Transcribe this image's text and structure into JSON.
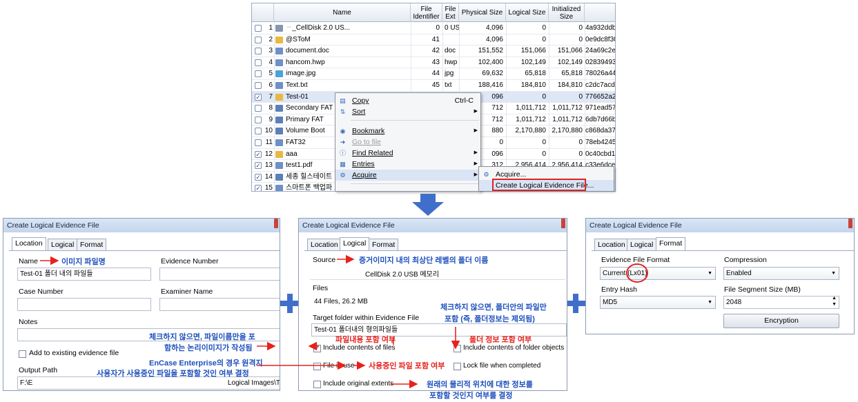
{
  "table": {
    "headers": [
      "Name",
      "File Identifier",
      "File Ext",
      "Physical Size",
      "Logical Size",
      "Initialized Size"
    ],
    "rows": [
      {
        "n": "1",
        "checked": false,
        "icon": "disk-icon",
        "name": "ᆢ_CellDisk 2.0 US...",
        "fid": "0",
        "ext": "0 US...",
        "phys": "4,096",
        "log": "0",
        "init": "0",
        "hash": "4a932ddb"
      },
      {
        "n": "2",
        "checked": false,
        "icon": "folder-icon",
        "name": "@SToM",
        "fid": "41",
        "ext": "",
        "phys": "4,096",
        "log": "0",
        "init": "0",
        "hash": "0e9dc8f30"
      },
      {
        "n": "3",
        "checked": false,
        "icon": "document-icon",
        "name": "document.doc",
        "fid": "42",
        "ext": "doc",
        "phys": "151,552",
        "log": "151,066",
        "init": "151,066",
        "hash": "24a69c2eb"
      },
      {
        "n": "4",
        "checked": false,
        "icon": "document-icon",
        "name": "hancom.hwp",
        "fid": "43",
        "ext": "hwp",
        "phys": "102,400",
        "log": "102,149",
        "init": "102,149",
        "hash": "02839493e"
      },
      {
        "n": "5",
        "checked": false,
        "icon": "image-icon",
        "name": "image.jpg",
        "fid": "44",
        "ext": "jpg",
        "phys": "69,632",
        "log": "65,818",
        "init": "65,818",
        "hash": "78026a442"
      },
      {
        "n": "6",
        "checked": false,
        "icon": "document-icon",
        "name": "Text.txt",
        "fid": "45",
        "ext": "txt",
        "phys": "188,416",
        "log": "184,810",
        "init": "184,810",
        "hash": "c2dc7acd0"
      },
      {
        "n": "7",
        "checked": true,
        "icon": "folder-icon",
        "name": "Test-01",
        "fid": "",
        "ext": "",
        "phys": "096",
        "log": "0",
        "init": "0",
        "hash": "776652a23"
      },
      {
        "n": "8",
        "checked": false,
        "icon": "system-icon",
        "name": "Secondary FAT",
        "fid": "",
        "ext": "",
        "phys": "712",
        "log": "1,011,712",
        "init": "1,011,712",
        "hash": "971ead57e"
      },
      {
        "n": "9",
        "checked": false,
        "icon": "system-icon",
        "name": "Primary FAT",
        "fid": "",
        "ext": "",
        "phys": "712",
        "log": "1,011,712",
        "init": "1,011,712",
        "hash": "6db7d66b"
      },
      {
        "n": "10",
        "checked": false,
        "icon": "system-icon",
        "name": "Volume Boot",
        "fid": "",
        "ext": "",
        "phys": "880",
        "log": "2,170,880",
        "init": "2,170,880",
        "hash": "c868da372"
      },
      {
        "n": "11",
        "checked": false,
        "icon": "document-icon",
        "name": "FAT32",
        "fid": "",
        "ext": "",
        "phys": "0",
        "log": "0",
        "init": "0",
        "hash": "78eb42455"
      },
      {
        "n": "12",
        "checked": true,
        "icon": "folder-icon",
        "name": "aaa",
        "fid": "",
        "ext": "",
        "phys": "096",
        "log": "0",
        "init": "0",
        "hash": "0c40cbd19"
      },
      {
        "n": "13",
        "checked": true,
        "icon": "document-icon",
        "name": "test1.pdf",
        "fid": "",
        "ext": "",
        "phys": "312",
        "log": "2,956,414",
        "init": "2,956,414",
        "hash": "c33e6dcea"
      },
      {
        "n": "14",
        "checked": true,
        "icon": "system-icon",
        "name": "세종 힐스테이트",
        "fid": "",
        "ext": "",
        "phys": "",
        "log": "",
        "init": "",
        "hash": ""
      },
      {
        "n": "15",
        "checked": true,
        "icon": "document-icon",
        "name": "스마트폰 백업파",
        "fid": "",
        "ext": "",
        "phys": "",
        "log": "",
        "init": "",
        "hash": ""
      }
    ]
  },
  "context_menu": {
    "items": [
      {
        "label": "Copy",
        "shortcut": "Ctrl-C",
        "icon": "copy-icon",
        "submenu": false,
        "disabled": false
      },
      {
        "label": "Sort",
        "shortcut": "",
        "icon": "sort-icon",
        "submenu": true,
        "disabled": false
      },
      {
        "label": "Bookmark",
        "shortcut": "",
        "icon": "bookmark-icon",
        "submenu": true,
        "disabled": false
      },
      {
        "label": "Go to file",
        "shortcut": "",
        "icon": "goto-icon",
        "submenu": false,
        "disabled": true
      },
      {
        "label": "Find Related",
        "shortcut": "",
        "icon": "find-icon",
        "submenu": true,
        "disabled": false
      },
      {
        "label": "Entries",
        "shortcut": "",
        "icon": "entries-icon",
        "submenu": true,
        "disabled": false
      },
      {
        "label": "Acquire",
        "shortcut": "",
        "icon": "acquire-icon",
        "submenu": true,
        "disabled": false
      }
    ],
    "submenu": {
      "acquire": "Acquire...",
      "create_lef": "Create Logical Evidence File..."
    }
  },
  "dialog_title": "Create Logical Evidence File",
  "tabs": {
    "location": "Location",
    "logical": "Logical",
    "format": "Format"
  },
  "location": {
    "name_label": "Name",
    "name_value": "Test-01 폴더 내의 파일들",
    "evidence_number_label": "Evidence Number",
    "case_number_label": "Case Number",
    "examiner_name_label": "Examiner Name",
    "notes_label": "Notes",
    "add_existing_label": "Add to existing evidence file",
    "output_path_label": "Output Path",
    "output_path_left": "F:\\E",
    "output_path_right": "Logical Images\\T"
  },
  "logical": {
    "source_label": "Source",
    "source_value": "CellDisk 2.0 USB 메모리",
    "files_label": "Files",
    "files_value": "44 Files, 26.2 MB",
    "target_label": "Target folder within Evidence File",
    "target_value": "Test-01 폴더내의 형의파일들",
    "include_contents_files": "Include contents of files",
    "include_contents_folders": "Include contents of folder objects",
    "file_in_use": "File in use",
    "lock_file": "Lock file when completed",
    "include_extents": "Include original extents"
  },
  "format": {
    "evidence_format_label": "Evidence File Format",
    "evidence_format_value": "Current (Lx01)",
    "compression_label": "Compression",
    "compression_value": "Enabled",
    "entry_hash_label": "Entry Hash",
    "entry_hash_value": "MD5",
    "segment_label": "File Segment Size (MB)",
    "segment_value": "2048",
    "encryption_button": "Encryption"
  },
  "annotations": {
    "name": "이미지 파일명",
    "source": "증거이미지 내의 최상단 레벨의 폴더 이름",
    "logical_hint_1": "체크하지 않으면, 폴더안의 파일만",
    "logical_hint_2": "포함 (즉, 폴더정보는 제외됨)",
    "file_contents": "파일내용 포함 여부",
    "folder_info": "폴더 정보 포함 여부",
    "file_in_use": "사용중인 파일 포함 여부",
    "extents_1": "원래의 물리적 위치에 대한 정보를",
    "extents_2": "포함할 것인지 여부를 결정",
    "unchecked_1": "체크하지 않으면, 파일이름만을 포",
    "unchecked_2": "함하는 논리이미지가 작성됨",
    "encase_1": "EnCase Enterprise의 경우 원격지",
    "encase_2": "사용자가 사용중인 파일을 포함할 것인 여부 결정"
  },
  "colors": {
    "accent_blue": "#1d4fbd",
    "accent_red": "#e8211c",
    "arrow_blue": "#3f6fca"
  }
}
